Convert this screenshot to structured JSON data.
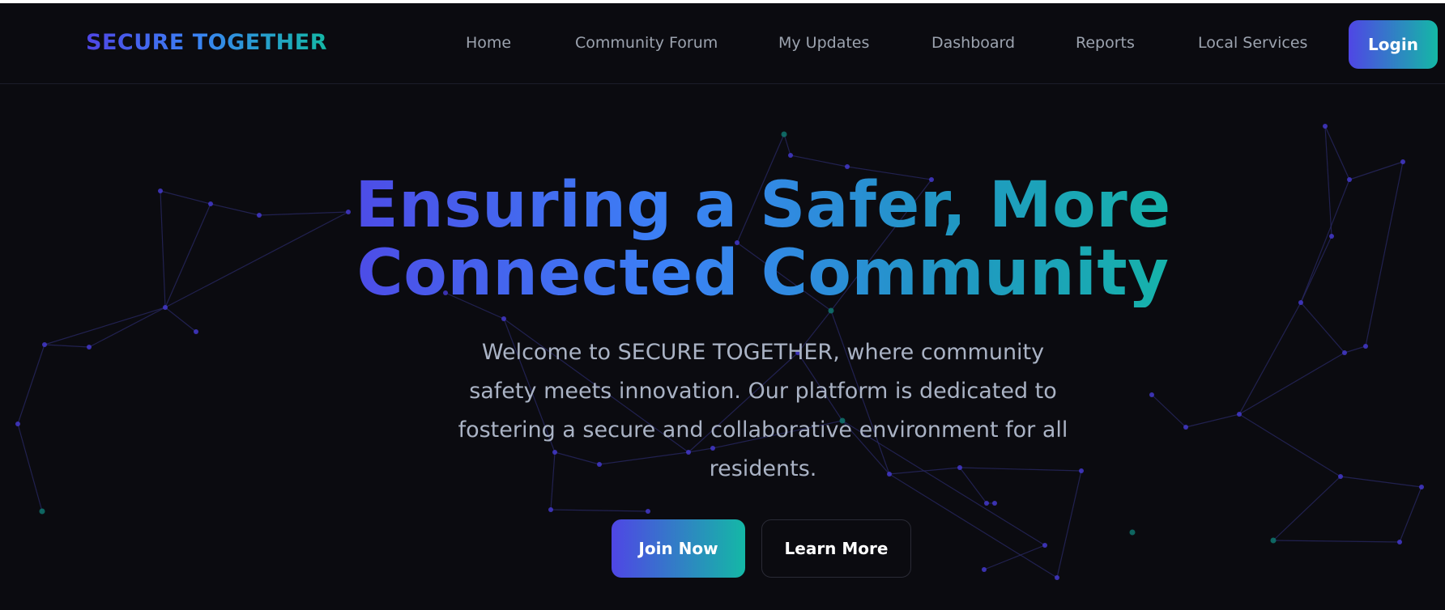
{
  "brand": {
    "name": "SECURE TOGETHER"
  },
  "nav": {
    "links": [
      {
        "label": "Home"
      },
      {
        "label": "Community Forum"
      },
      {
        "label": "My Updates"
      },
      {
        "label": "Dashboard"
      },
      {
        "label": "Reports"
      },
      {
        "label": "Local Services"
      }
    ],
    "login_label": "Login"
  },
  "hero": {
    "title_line1": "Ensuring a Safer, More",
    "title_line2": "Connected Community",
    "description": "Welcome to SECURE TOGETHER, where community safety meets innovation. Our platform is dedicated to fostering a secure and collaborative environment for all residents.",
    "primary_cta": "Join Now",
    "secondary_cta": "Learn More"
  },
  "theme": {
    "background": "#0b0b10",
    "gradient_start": "#4f46e5",
    "gradient_end": "#14b8a6",
    "nav_text": "#9ca3af",
    "body_text": "#aab3c5",
    "network_line": "#2a2a66",
    "node_purple": "#4338ca",
    "node_teal": "#0f766e"
  }
}
